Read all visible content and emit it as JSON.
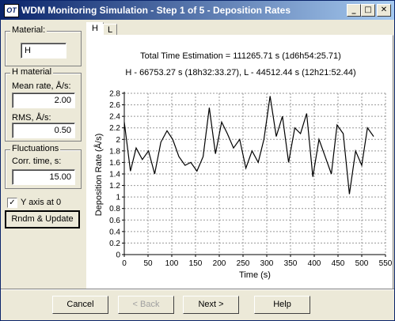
{
  "window": {
    "title": "WDM Monitoring Simulation - Step 1 of 5 - Deposition Rates",
    "app_icon_text": "OT",
    "controls": {
      "minimize": "_",
      "maximize": "□",
      "close": "✕"
    }
  },
  "material": {
    "group_label": "Material:",
    "value": "H"
  },
  "h_material": {
    "group_label": "H material",
    "mean_rate_label": "Mean rate, Å/s:",
    "mean_rate_value": "2.00",
    "rms_label": "RMS, Å/s:",
    "rms_value": "0.50"
  },
  "fluctuations": {
    "group_label": "Fluctuations",
    "corr_time_label": "Corr. time, s:",
    "corr_time_value": "15.00"
  },
  "y_axis_checkbox": {
    "label": "Y axis at 0",
    "checked": true
  },
  "rndm_update_button": "Rndm & Update",
  "tabs": [
    {
      "label": "H",
      "active": true
    },
    {
      "label": "L",
      "active": false
    }
  ],
  "plot": {
    "total_time_text": "Total Time Estimation = 111265.71 s (1d6h54:25.71)",
    "split_time_text": "H - 66753.27 s (18h32:33.27), L - 44512.44 s (12h21:52.44)"
  },
  "footer": {
    "cancel": "Cancel",
    "back": "< Back",
    "next": "Next >",
    "help": "Help"
  },
  "chart_data": {
    "type": "line",
    "xlabel": "Time (s)",
    "ylabel": "Deposition Rate (Å/s)",
    "xlim": [
      0,
      550
    ],
    "ylim": [
      0,
      2.8
    ],
    "x_ticks": [
      0,
      50,
      100,
      150,
      200,
      250,
      300,
      350,
      400,
      450,
      500,
      550
    ],
    "y_ticks": [
      0,
      0.2,
      0.4,
      0.6,
      0.8,
      1,
      1.2,
      1.4,
      1.6,
      1.8,
      2,
      2.2,
      2.4,
      2.6,
      2.8
    ],
    "grid": true,
    "line_color": "#000000",
    "x": [
      0,
      13,
      25,
      38,
      51,
      64,
      77,
      90,
      102,
      115,
      128,
      140,
      153,
      166,
      179,
      192,
      205,
      217,
      230,
      243,
      256,
      269,
      282,
      294,
      307,
      320,
      333,
      346,
      359,
      371,
      384,
      397,
      410,
      423,
      436,
      448,
      461,
      474,
      487,
      500,
      512,
      525
    ],
    "y": [
      2.3,
      1.45,
      1.85,
      1.65,
      1.8,
      1.4,
      1.95,
      2.15,
      2.0,
      1.7,
      1.55,
      1.6,
      1.45,
      1.7,
      2.55,
      1.75,
      2.3,
      2.1,
      1.85,
      2.0,
      1.5,
      1.8,
      1.6,
      2.0,
      2.75,
      2.05,
      2.4,
      1.6,
      2.2,
      2.1,
      2.45,
      1.35,
      2.0,
      1.7,
      1.4,
      2.25,
      2.1,
      1.05,
      1.8,
      1.55,
      2.2,
      2.05
    ]
  }
}
